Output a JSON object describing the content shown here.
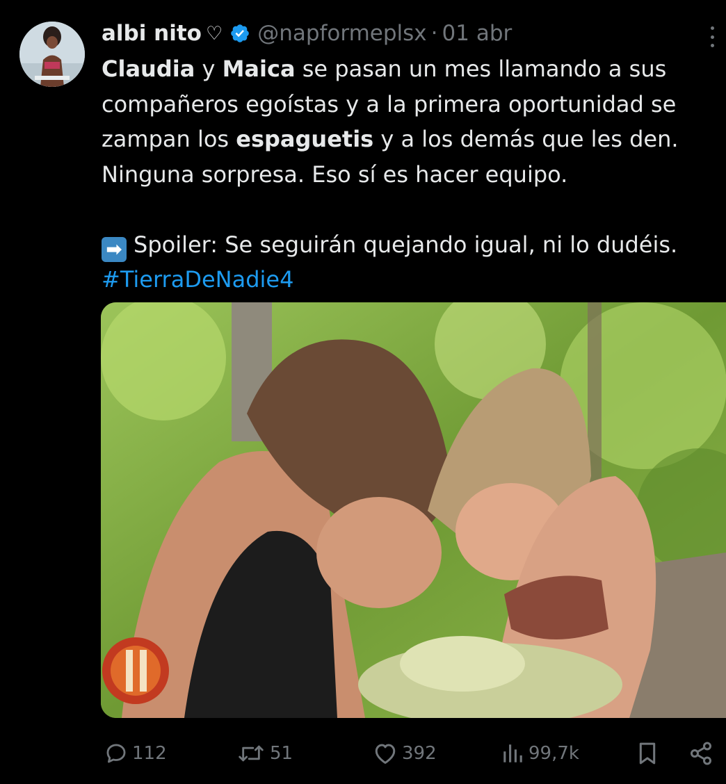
{
  "author": {
    "name": "albi nito",
    "name_emoji": "♡",
    "handle": "@napformeplsx",
    "separator": "·",
    "date": "01 abr"
  },
  "tweet": {
    "lines": [
      [
        {
          "t": "Claudia",
          "b": true
        },
        {
          "t": " y "
        },
        {
          "t": "Maica",
          "b": true
        },
        {
          "t": " se pasan un mes llamando a sus"
        }
      ],
      [
        {
          "t": "compañeros egoístas y a la primera oportunidad se"
        }
      ],
      [
        {
          "t": "zampan los "
        },
        {
          "t": "espaguetis",
          "b": true
        },
        {
          "t": " y a los demás que les den."
        }
      ],
      [
        {
          "t": "Ninguna sorpresa. Eso sí es hacer equipo."
        }
      ]
    ],
    "spoiler_emoji": "➡",
    "spoiler_text": "Spoiler: Se seguirán quejando igual, ni lo dudéis.",
    "hashtag": "#TierraDeNadie4"
  },
  "media": {
    "description_icon": "photo"
  },
  "actions": {
    "replies": "112",
    "retweets": "51",
    "likes": "392",
    "views": "99,7k"
  },
  "colors": {
    "background": "#000000",
    "text": "#e7e9ea",
    "secondary": "#71767b",
    "link": "#1d9bf0",
    "verified": "#1d9bf0"
  },
  "icons": [
    "verified-badge-icon",
    "more-icon",
    "reply-icon",
    "retweet-icon",
    "like-icon",
    "views-icon",
    "bookmark-icon",
    "share-icon"
  ]
}
